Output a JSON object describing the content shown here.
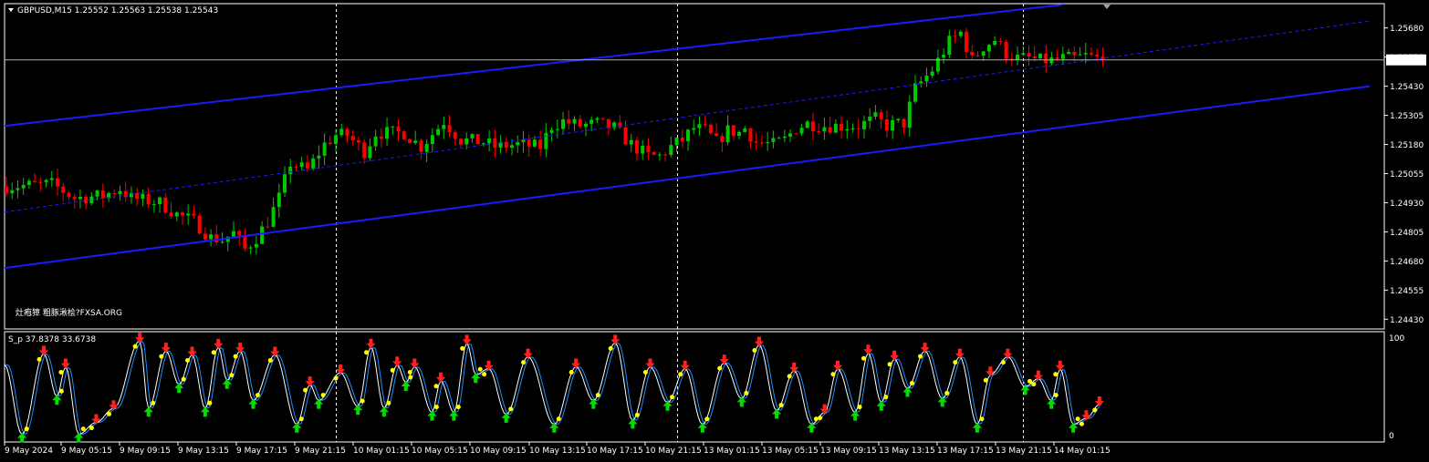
{
  "header": {
    "symbol_timeframe": "GBPUSD,M15",
    "ohlc": "1.25552 1.25563 1.25538 1.25543"
  },
  "watermark": "灶疱獐 粗豚湫桧?FXSA.ORG",
  "colors": {
    "background": "#000000",
    "bull_candle": "#00c800",
    "bear_candle": "#ff0000",
    "channel": "#1a1aff",
    "grid": "#ffffff",
    "indicator_main": "#ffffff",
    "indicator_signal": "#1e90ff",
    "dot": "#ffff00",
    "up_arrow": "#00dd00",
    "down_arrow": "#ff2020"
  },
  "chart_data": [
    {
      "type": "candlestick",
      "symbol": "GBPUSD",
      "timeframe": "M15",
      "current_price": "1.25543",
      "ylim": [
        1.244,
        1.258
      ],
      "y_ticks": [
        "1.25680",
        "1.25555",
        "1.25430",
        "1.25305",
        "1.25180",
        "1.25055",
        "1.24930",
        "1.24805",
        "1.24680",
        "1.24555",
        "1.24430"
      ],
      "path_points": [
        [
          0,
          1.25
        ],
        [
          8,
          1.2501
        ],
        [
          12,
          1.2495
        ],
        [
          17,
          1.2496
        ],
        [
          20,
          1.2499
        ],
        [
          22,
          1.2495
        ],
        [
          27,
          1.2493
        ],
        [
          30,
          1.2488
        ],
        [
          33,
          1.2485
        ],
        [
          36,
          1.2478
        ],
        [
          38,
          1.2477
        ],
        [
          40,
          1.248
        ],
        [
          42,
          1.2473
        ],
        [
          44,
          1.2478
        ],
        [
          46,
          1.2485
        ],
        [
          48,
          1.2495
        ],
        [
          50,
          1.251
        ],
        [
          53,
          1.2507
        ],
        [
          56,
          1.2518
        ],
        [
          58,
          1.2522
        ],
        [
          60,
          1.2522
        ],
        [
          63,
          1.2515
        ],
        [
          65,
          1.2523
        ],
        [
          70,
          1.2523
        ],
        [
          73,
          1.2517
        ],
        [
          77,
          1.2528
        ],
        [
          80,
          1.252
        ],
        [
          84,
          1.2519
        ],
        [
          86,
          1.2517
        ],
        [
          90,
          1.2518
        ],
        [
          94,
          1.2517
        ],
        [
          96,
          1.2526
        ],
        [
          98,
          1.2528
        ],
        [
          101,
          1.2526
        ],
        [
          104,
          1.2527
        ],
        [
          107,
          1.2525
        ],
        [
          110,
          1.2518
        ],
        [
          113,
          1.2513
        ],
        [
          115,
          1.2513
        ],
        [
          117,
          1.2517
        ],
        [
          119,
          1.252
        ],
        [
          121,
          1.2525
        ],
        [
          123,
          1.2524
        ],
        [
          125,
          1.2519
        ],
        [
          127,
          1.2524
        ],
        [
          129,
          1.2523
        ],
        [
          130,
          1.2525
        ],
        [
          132,
          1.2519
        ],
        [
          135,
          1.2518
        ],
        [
          137,
          1.252
        ],
        [
          139,
          1.2525
        ],
        [
          141,
          1.2527
        ],
        [
          144,
          1.2526
        ],
        [
          147,
          1.2526
        ],
        [
          150,
          1.2526
        ],
        [
          153,
          1.2529
        ],
        [
          155,
          1.2526
        ],
        [
          157,
          1.2527
        ],
        [
          158,
          1.2527
        ],
        [
          160,
          1.2542
        ],
        [
          163,
          1.255
        ],
        [
          166,
          1.2562
        ],
        [
          168,
          1.2566
        ],
        [
          170,
          1.2554
        ],
        [
          172,
          1.256
        ],
        [
          174,
          1.2563
        ],
        [
          176,
          1.2557
        ],
        [
          178,
          1.2555
        ],
        [
          180,
          1.2555
        ],
        [
          182,
          1.2554
        ],
        [
          184,
          1.2554
        ],
        [
          186,
          1.2555
        ],
        [
          188,
          1.2555
        ],
        [
          190,
          1.2556
        ],
        [
          192,
          1.2555
        ],
        [
          193,
          1.2554
        ]
      ],
      "channel_lines": [
        {
          "name": "upper",
          "points": [
            [
              0,
              1.2526
            ],
            [
              186,
              1.2578
            ]
          ]
        },
        {
          "name": "middle",
          "points": [
            [
              0,
              1.2489
            ],
            [
              240,
              1.2571
            ]
          ],
          "dashed": true
        },
        {
          "name": "lower",
          "points": [
            [
              0,
              1.2465
            ],
            [
              240,
              1.2543
            ]
          ]
        }
      ],
      "session_separators_at_bar": [
        58,
        118,
        179
      ],
      "x_ticks": [
        "9 May 2024",
        "9 May 05:15",
        "9 May 09:15",
        "9 May 13:15",
        "9 May 17:15",
        "9 May 21:15",
        "10 May 01:15",
        "10 May 05:15",
        "10 May 09:15",
        "10 May 13:15",
        "10 May 17:15",
        "10 May 21:15",
        "13 May 01:15",
        "13 May 05:15",
        "13 May 09:15",
        "13 May 13:15",
        "13 May 17:15",
        "13 May 21:15",
        "14 May 01:15"
      ]
    },
    {
      "type": "line",
      "name": "S_p",
      "label": "S_p 37.8378 33.6738",
      "ylim": [
        0,
        100
      ],
      "y_ticks": [
        "100",
        "0"
      ],
      "peaks": [
        [
          0,
          74
        ],
        [
          4,
          4
        ],
        [
          9,
          85
        ],
        [
          12,
          42
        ],
        [
          14,
          72
        ],
        [
          17,
          4
        ],
        [
          21,
          16
        ],
        [
          25,
          30
        ],
        [
          31,
          98
        ],
        [
          33,
          30
        ],
        [
          37,
          88
        ],
        [
          40,
          54
        ],
        [
          43,
          84
        ],
        [
          46,
          30
        ],
        [
          49,
          92
        ],
        [
          51,
          58
        ],
        [
          54,
          88
        ],
        [
          57,
          38
        ],
        [
          62,
          84
        ],
        [
          67,
          14
        ],
        [
          70,
          54
        ],
        [
          72,
          38
        ],
        [
          77,
          66
        ],
        [
          81,
          32
        ],
        [
          84,
          92
        ],
        [
          87,
          30
        ],
        [
          90,
          74
        ],
        [
          92,
          56
        ],
        [
          94,
          72
        ],
        [
          98,
          26
        ],
        [
          100,
          58
        ],
        [
          103,
          26
        ],
        [
          106,
          96
        ],
        [
          108,
          64
        ],
        [
          111,
          70
        ],
        [
          115,
          24
        ],
        [
          120,
          82
        ],
        [
          126,
          14
        ],
        [
          131,
          72
        ],
        [
          135,
          38
        ],
        [
          140,
          96
        ],
        [
          144,
          18
        ],
        [
          148,
          72
        ],
        [
          152,
          36
        ],
        [
          156,
          70
        ],
        [
          160,
          14
        ],
        [
          165,
          76
        ],
        [
          169,
          40
        ],
        [
          173,
          94
        ],
        [
          177,
          28
        ],
        [
          181,
          68
        ],
        [
          185,
          14
        ],
        [
          188,
          26
        ],
        [
          191,
          70
        ],
        [
          195,
          26
        ],
        [
          198,
          86
        ],
        [
          201,
          36
        ],
        [
          204,
          80
        ],
        [
          207,
          50
        ],
        [
          211,
          88
        ],
        [
          215,
          40
        ],
        [
          219,
          82
        ],
        [
          223,
          14
        ],
        [
          226,
          64
        ],
        [
          230,
          82
        ],
        [
          234,
          52
        ],
        [
          237,
          60
        ],
        [
          240,
          38
        ],
        [
          242,
          70
        ],
        [
          245,
          14
        ],
        [
          248,
          20
        ],
        [
          251,
          34
        ]
      ]
    }
  ]
}
